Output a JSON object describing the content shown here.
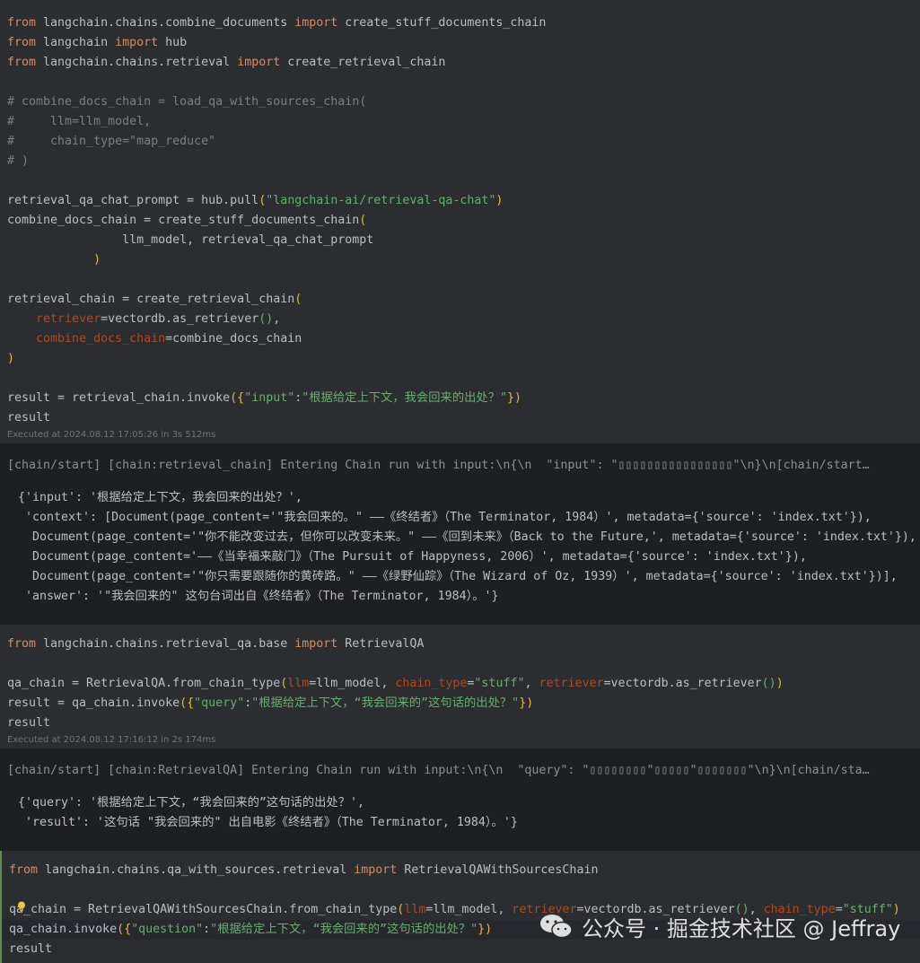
{
  "colors": {
    "keyword": "#cf8e6d",
    "string": "#6aab73",
    "comment": "#7a7e85",
    "param": "#aa4926",
    "bracket": "#e8ba36",
    "text": "#bcbec4",
    "cell_bg": "#2b2d30",
    "output_bg": "#1e1f22"
  },
  "cell1": {
    "lines": [
      [
        {
          "t": "from ",
          "c": "kw"
        },
        {
          "t": "langchain.chains.combine_documents ",
          "c": "fn"
        },
        {
          "t": "import ",
          "c": "kw"
        },
        {
          "t": "create_stuff_documents_chain",
          "c": "fn"
        }
      ],
      [
        {
          "t": "from ",
          "c": "kw"
        },
        {
          "t": "langchain ",
          "c": "fn"
        },
        {
          "t": "import ",
          "c": "kw"
        },
        {
          "t": "hub",
          "c": "fn"
        }
      ],
      [
        {
          "t": "from ",
          "c": "kw"
        },
        {
          "t": "langchain.chains.retrieval ",
          "c": "fn"
        },
        {
          "t": "import ",
          "c": "kw"
        },
        {
          "t": "create_retrieval_chain",
          "c": "fn"
        }
      ],
      [],
      [
        {
          "t": "# combine_docs_chain = load_qa_with_sources_chain(",
          "c": "cm"
        }
      ],
      [
        {
          "t": "#     llm=llm_model,",
          "c": "cm"
        }
      ],
      [
        {
          "t": "#     chain_type=\"map_reduce\"",
          "c": "cm"
        }
      ],
      [
        {
          "t": "# )",
          "c": "cm"
        }
      ],
      [],
      [
        {
          "t": "retrieval_qa_chat_prompt = hub.pull",
          "c": "fn"
        },
        {
          "t": "(",
          "c": "br"
        },
        {
          "t": "\"langchain-ai/retrieval-qa-chat\"",
          "c": "str"
        },
        {
          "t": ")",
          "c": "br"
        }
      ],
      [
        {
          "t": "combine_docs_chain = create_stuff_documents_chain",
          "c": "fn"
        },
        {
          "t": "(",
          "c": "br"
        }
      ],
      [
        {
          "t": "                llm_model, retrieval_qa_chat_prompt",
          "c": "fn"
        }
      ],
      [
        {
          "t": "            ",
          "c": "fn"
        },
        {
          "t": ")",
          "c": "br"
        }
      ],
      [],
      [
        {
          "t": "retrieval_chain = create_retrieval_chain",
          "c": "fn"
        },
        {
          "t": "(",
          "c": "br"
        }
      ],
      [
        {
          "t": "    ",
          "c": "fn"
        },
        {
          "t": "retriever",
          "c": "param"
        },
        {
          "t": "=vectordb.as_retriever",
          "c": "fn"
        },
        {
          "t": "()",
          "c": "str"
        },
        {
          "t": ",",
          "c": "fn"
        }
      ],
      [
        {
          "t": "    ",
          "c": "fn"
        },
        {
          "t": "combine_docs_chain",
          "c": "param"
        },
        {
          "t": "=combine_docs_chain",
          "c": "fn"
        }
      ],
      [
        {
          "t": ")",
          "c": "br"
        }
      ],
      [],
      [
        {
          "t": "result = retrieval_chain.invoke",
          "c": "fn"
        },
        {
          "t": "({",
          "c": "br"
        },
        {
          "t": "\"input\"",
          "c": "str"
        },
        {
          "t": ":",
          "c": "fn"
        },
        {
          "t": "\"根据给定上下文，我会回来的出处？\"",
          "c": "str"
        },
        {
          "t": "})",
          "c": "br"
        }
      ],
      [
        {
          "t": "result",
          "c": "fn"
        }
      ]
    ],
    "executed": "Executed at 2024.08.12 17:05:26 in 3s 512ms"
  },
  "output1": {
    "log": "[chain/start] [chain:retrieval_chain] Entering Chain run with input:\\n{\\n  \"input\": \"▯▯▯▯▯▯▯▯▯▯▯▯▯▯▯▯\"\\n}\\n[chain/start…",
    "result_lines": [
      "{'input': '根据给定上下文，我会回来的出处？',",
      " 'context': [Document(page_content='\"我会回来的。\" ——《终结者》（The Terminator, 1984）', metadata={'source': 'index.txt'}),",
      "  Document(page_content='\"你不能改变过去，但你可以改变未来。\" ——《回到未来》（Back to the Future,', metadata={'source': 'index.txt'}),",
      "  Document(page_content='——《当幸福来敲门》（The Pursuit of Happyness, 2006）', metadata={'source': 'index.txt'}),",
      "  Document(page_content='\"你只需要跟随你的黄砖路。\" ——《绿野仙踪》（The Wizard of Oz, 1939）', metadata={'source': 'index.txt'})],",
      " 'answer': '\"我会回来的\" 这句台词出自《终结者》（The Terminator, 1984）。'}"
    ]
  },
  "cell2": {
    "lines": [
      [
        {
          "t": "from ",
          "c": "kw"
        },
        {
          "t": "langchain.chains.retrieval_qa.base ",
          "c": "fn"
        },
        {
          "t": "import ",
          "c": "kw"
        },
        {
          "t": "RetrievalQA",
          "c": "fn"
        }
      ],
      [],
      [
        {
          "t": "qa_chain = RetrievalQA.from_chain_type",
          "c": "fn"
        },
        {
          "t": "(",
          "c": "br"
        },
        {
          "t": "llm",
          "c": "param"
        },
        {
          "t": "=llm_model, ",
          "c": "fn"
        },
        {
          "t": "chain_type",
          "c": "param"
        },
        {
          "t": "=",
          "c": "fn"
        },
        {
          "t": "\"stuff\"",
          "c": "str"
        },
        {
          "t": ", ",
          "c": "fn"
        },
        {
          "t": "retriever",
          "c": "param"
        },
        {
          "t": "=vectordb.as_retriever",
          "c": "fn"
        },
        {
          "t": "()",
          "c": "str"
        },
        {
          "t": ")",
          "c": "br"
        }
      ],
      [
        {
          "t": "result = qa_chain.invoke",
          "c": "fn"
        },
        {
          "t": "({",
          "c": "br"
        },
        {
          "t": "\"query\"",
          "c": "str"
        },
        {
          "t": ":",
          "c": "fn"
        },
        {
          "t": "\"根据给定上下文，“我会回来的”这句话的出处？\"",
          "c": "str"
        },
        {
          "t": "})",
          "c": "br"
        }
      ],
      [
        {
          "t": "result",
          "c": "fn"
        }
      ]
    ],
    "executed": "Executed at 2024.08.12 17:16:12 in 2s 174ms"
  },
  "output2": {
    "log": "[chain/start] [chain:RetrievalQA] Entering Chain run with input:\\n{\\n  \"query\": \"▯▯▯▯▯▯▯▯\"▯▯▯▯▯\"▯▯▯▯▯▯▯\"\\n}\\n[chain/sta…",
    "result_lines": [
      "{'query': '根据给定上下文，“我会回来的”这句话的出处？',",
      " 'result': '这句话 \"我会回来的\" 出自电影《终结者》（The Terminator, 1984）。'}"
    ]
  },
  "cell3": {
    "lines": [
      [
        {
          "t": "from ",
          "c": "kw"
        },
        {
          "t": "langchain.chains.qa_with_sources.retrieval ",
          "c": "fn"
        },
        {
          "t": "import ",
          "c": "kw"
        },
        {
          "t": "RetrievalQAWithSourcesChain",
          "c": "fn"
        }
      ],
      [],
      [
        {
          "t": "qa_chain = RetrievalQAWithSourcesChain.from_chain_type",
          "c": "fn"
        },
        {
          "t": "(",
          "c": "br"
        },
        {
          "t": "llm",
          "c": "param"
        },
        {
          "t": "=llm_model, ",
          "c": "fn"
        },
        {
          "t": "retriever",
          "c": "param"
        },
        {
          "t": "=vectordb.as_retriever",
          "c": "fn"
        },
        {
          "t": "()",
          "c": "str"
        },
        {
          "t": ", ",
          "c": "fn"
        },
        {
          "t": "chain_type",
          "c": "param"
        },
        {
          "t": "=",
          "c": "fn"
        },
        {
          "t": "\"stuff\"",
          "c": "str"
        },
        {
          "t": ")",
          "c": "br"
        }
      ],
      [
        {
          "t": "qa_chain.invoke",
          "c": "fn"
        },
        {
          "t": "({",
          "c": "br"
        },
        {
          "t": "\"question\"",
          "c": "str"
        },
        {
          "t": ":",
          "c": "fn"
        },
        {
          "t": "\"根据给定上下文，“我会回来的”这句话的出处？\"",
          "c": "str"
        },
        {
          "t": "})",
          "c": "br"
        }
      ],
      [
        {
          "t": "result",
          "c": "fn"
        }
      ]
    ]
  },
  "watermark": {
    "text": "公众号 · 掘金技术社区 @ Jeffray",
    "icon": "wechat-icon"
  }
}
